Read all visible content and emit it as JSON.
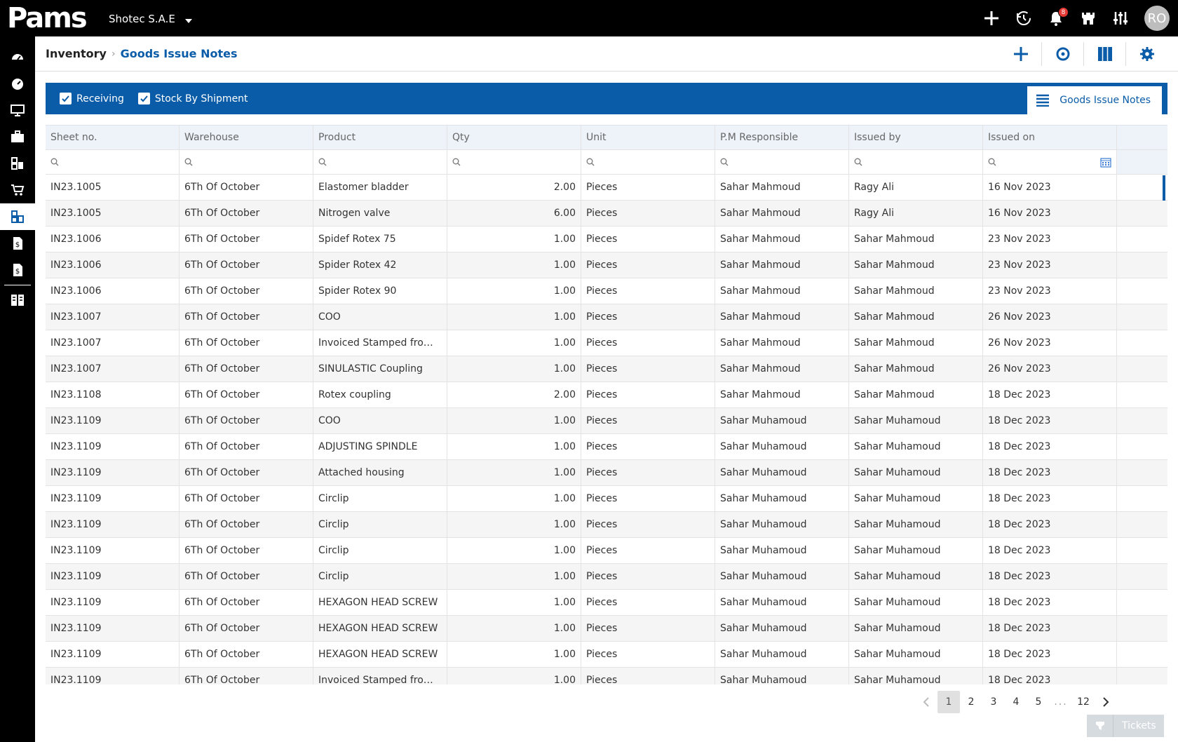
{
  "app": {
    "logo": "Pams",
    "company": "Shotec S.A.E",
    "notifications_count": "8",
    "user_initials": "RO"
  },
  "breadcrumb": {
    "root": "Inventory",
    "current": "Goods Issue Notes"
  },
  "filters": {
    "receiving_label": "Receiving",
    "stock_by_shipment_label": "Stock By Shipment",
    "view_tab_label": "Goods Issue Notes"
  },
  "table": {
    "columns": [
      "Sheet no.",
      "Warehouse",
      "Product",
      "Qty",
      "Unit",
      "P.M Responsible",
      "Issued by",
      "Issued on"
    ],
    "rows": [
      [
        "IN23.1005",
        "6Th Of October",
        "Elastomer bladder",
        "2.00",
        "Pieces",
        "Sahar Mahmoud",
        "Ragy Ali",
        "16 Nov 2023"
      ],
      [
        "IN23.1005",
        "6Th Of October",
        "Nitrogen valve",
        "6.00",
        "Pieces",
        "Sahar Mahmoud",
        "Ragy Ali",
        "16 Nov 2023"
      ],
      [
        "IN23.1006",
        "6Th Of October",
        "Spidef Rotex 75",
        "1.00",
        "Pieces",
        "Sahar Mahmoud",
        "Sahar Mahmoud",
        "23 Nov 2023"
      ],
      [
        "IN23.1006",
        "6Th Of October",
        "Spider Rotex 42",
        "1.00",
        "Pieces",
        "Sahar Mahmoud",
        "Sahar Mahmoud",
        "23 Nov 2023"
      ],
      [
        "IN23.1006",
        "6Th Of October",
        "Spider Rotex 90",
        "1.00",
        "Pieces",
        "Sahar Mahmoud",
        "Sahar Mahmoud",
        "23 Nov 2023"
      ],
      [
        "IN23.1007",
        "6Th Of October",
        "COO",
        "1.00",
        "Pieces",
        "Sahar Mahmoud",
        "Sahar Mahmoud",
        "26 Nov 2023"
      ],
      [
        "IN23.1007",
        "6Th Of October",
        "Invoiced Stamped from Chamber of Commerce",
        "1.00",
        "Pieces",
        "Sahar Mahmoud",
        "Sahar Mahmoud",
        "26 Nov 2023"
      ],
      [
        "IN23.1007",
        "6Th Of October",
        "SINULASTIC Coupling",
        "1.00",
        "Pieces",
        "Sahar Mahmoud",
        "Sahar Mahmoud",
        "26 Nov 2023"
      ],
      [
        "IN23.1108",
        "6Th Of October",
        "Rotex coupling",
        "2.00",
        "Pieces",
        "Sahar Mahmoud",
        "Sahar Mahmoud",
        "18 Dec 2023"
      ],
      [
        "IN23.1109",
        "6Th Of October",
        "COO",
        "1.00",
        "Pieces",
        "Sahar Muhamoud",
        "Sahar Muhamoud",
        "18 Dec 2023"
      ],
      [
        "IN23.1109",
        "6Th Of October",
        "ADJUSTING SPINDLE",
        "1.00",
        "Pieces",
        "Sahar Muhamoud",
        "Sahar Muhamoud",
        "18 Dec 2023"
      ],
      [
        "IN23.1109",
        "6Th Of October",
        "Attached housing",
        "1.00",
        "Pieces",
        "Sahar Muhamoud",
        "Sahar Muhamoud",
        "18 Dec 2023"
      ],
      [
        "IN23.1109",
        "6Th Of October",
        "Circlip",
        "1.00",
        "Pieces",
        "Sahar Muhamoud",
        "Sahar Muhamoud",
        "18 Dec 2023"
      ],
      [
        "IN23.1109",
        "6Th Of October",
        "Circlip",
        "1.00",
        "Pieces",
        "Sahar Muhamoud",
        "Sahar Muhamoud",
        "18 Dec 2023"
      ],
      [
        "IN23.1109",
        "6Th Of October",
        "Circlip",
        "1.00",
        "Pieces",
        "Sahar Muhamoud",
        "Sahar Muhamoud",
        "18 Dec 2023"
      ],
      [
        "IN23.1109",
        "6Th Of October",
        "Circlip",
        "1.00",
        "Pieces",
        "Sahar Muhamoud",
        "Sahar Muhamoud",
        "18 Dec 2023"
      ],
      [
        "IN23.1109",
        "6Th Of October",
        "HEXAGON HEAD SCREW",
        "1.00",
        "Pieces",
        "Sahar Muhamoud",
        "Sahar Muhamoud",
        "18 Dec 2023"
      ],
      [
        "IN23.1109",
        "6Th Of October",
        "HEXAGON HEAD SCREW",
        "1.00",
        "Pieces",
        "Sahar Muhamoud",
        "Sahar Muhamoud",
        "18 Dec 2023"
      ],
      [
        "IN23.1109",
        "6Th Of October",
        "HEXAGON HEAD SCREW",
        "1.00",
        "Pieces",
        "Sahar Muhamoud",
        "Sahar Muhamoud",
        "18 Dec 2023"
      ],
      [
        "IN23.1109",
        "6Th Of October",
        "Invoiced Stamped from Chamber of Commerce",
        "1.00",
        "Pieces",
        "Sahar Muhamoud",
        "Sahar Muhamoud",
        "18 Dec 2023"
      ]
    ]
  },
  "pagination": {
    "pages": [
      "1",
      "2",
      "3",
      "4",
      "5"
    ],
    "ellipsis": "...",
    "last_page": "12",
    "current": "1"
  },
  "tickets": {
    "label": "Tickets"
  },
  "colors": {
    "accent": "#0a5ca8",
    "topbar": "#000000",
    "header_row": "#eef3fa",
    "alt_row": "#f5f5f5",
    "badge": "#e53935"
  },
  "icons": {
    "topbar": [
      "plus-icon",
      "history-icon",
      "bell-icon",
      "castle-icon",
      "sliders-icon"
    ],
    "sidebar": [
      "dashboard-icon",
      "gauge-icon",
      "monitor-icon",
      "briefcase-icon",
      "inventory-icon",
      "cart-icon",
      "goods-issue-icon",
      "invoice-icon",
      "invoice-dollar-icon",
      "reports-icon"
    ],
    "actions": [
      "add-icon",
      "refresh-icon",
      "columns-icon",
      "settings-icon"
    ]
  }
}
